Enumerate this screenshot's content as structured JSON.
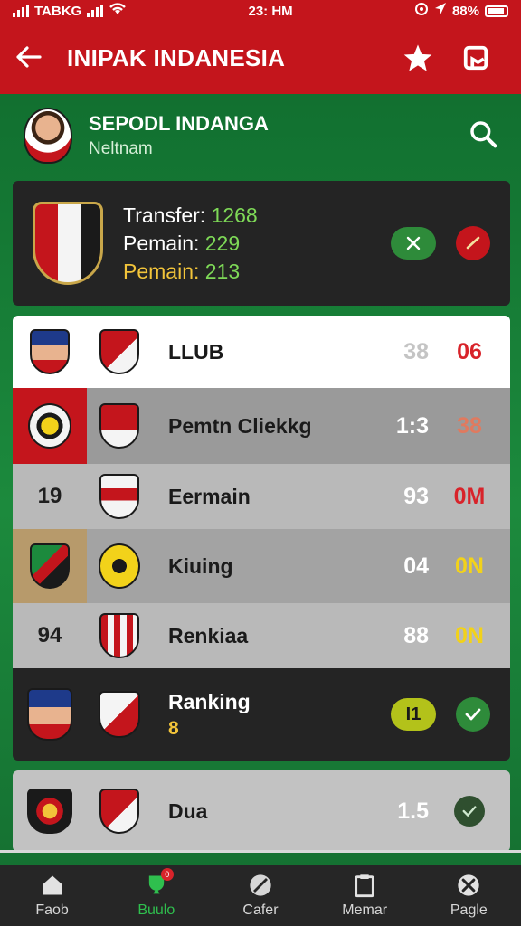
{
  "status_bar": {
    "left": "TABKG",
    "time": "23: HM",
    "battery": "88%"
  },
  "app_bar": {
    "title": "INIPAK INDANESIA"
  },
  "profile": {
    "name": "SEPODL INDANGA",
    "subtitle": "Neltnam"
  },
  "summary": {
    "line1_label": "Transfer:",
    "line1_value": "1268",
    "line2_label": "Pemain:",
    "line2_value": "229",
    "line3_label": "Pemain:",
    "line3_value": "213"
  },
  "rows": [
    {
      "name": "LLUB",
      "n1": "38",
      "n2": "06",
      "n1_color": "#c4c4c4",
      "n2_color": "#d8232a",
      "bg": "#ffffff",
      "name_color": "#1a1a1a"
    },
    {
      "name": "Pemtn Cliekkg",
      "n1": "1:3",
      "n2": "38",
      "n1_color": "#ffffff",
      "n2_color": "#e07a5f",
      "bg": "#9a9a9a",
      "name_color": "#1a1a1a",
      "accent": "#c4151c"
    },
    {
      "rank": "19",
      "name": "Eermain",
      "n1": "93",
      "n2": "0M",
      "n1_color": "#ffffff",
      "n2_color": "#d8232a",
      "bg": "#b9b9b9",
      "name_color": "#1a1a1a"
    },
    {
      "name": "Kiuing",
      "n1": "04",
      "n2": "0N",
      "n1_color": "#ffffff",
      "n2_color": "#f2d21a",
      "bg": "#a3a3a3",
      "name_color": "#1a1a1a",
      "accent": "#b79a6b"
    },
    {
      "rank": "94",
      "name": "Renkiaa",
      "n1": "88",
      "n2": "0N",
      "n1_color": "#ffffff",
      "n2_color": "#f2d21a",
      "bg": "#b9b9b9",
      "name_color": "#1a1a1a"
    }
  ],
  "featured": {
    "name": "Ranking",
    "sub": "8",
    "pill": "I1"
  },
  "last_row": {
    "name": "Dua",
    "n1": "1.5"
  },
  "nav": [
    {
      "label": "Faob",
      "icon": "home-icon"
    },
    {
      "label": "Buulo",
      "icon": "trophy-icon",
      "badge": "0"
    },
    {
      "label": "Cafer",
      "icon": "ball-icon"
    },
    {
      "label": "Memar",
      "icon": "clipboard-icon"
    },
    {
      "label": "Pagle",
      "icon": "close-icon"
    }
  ]
}
